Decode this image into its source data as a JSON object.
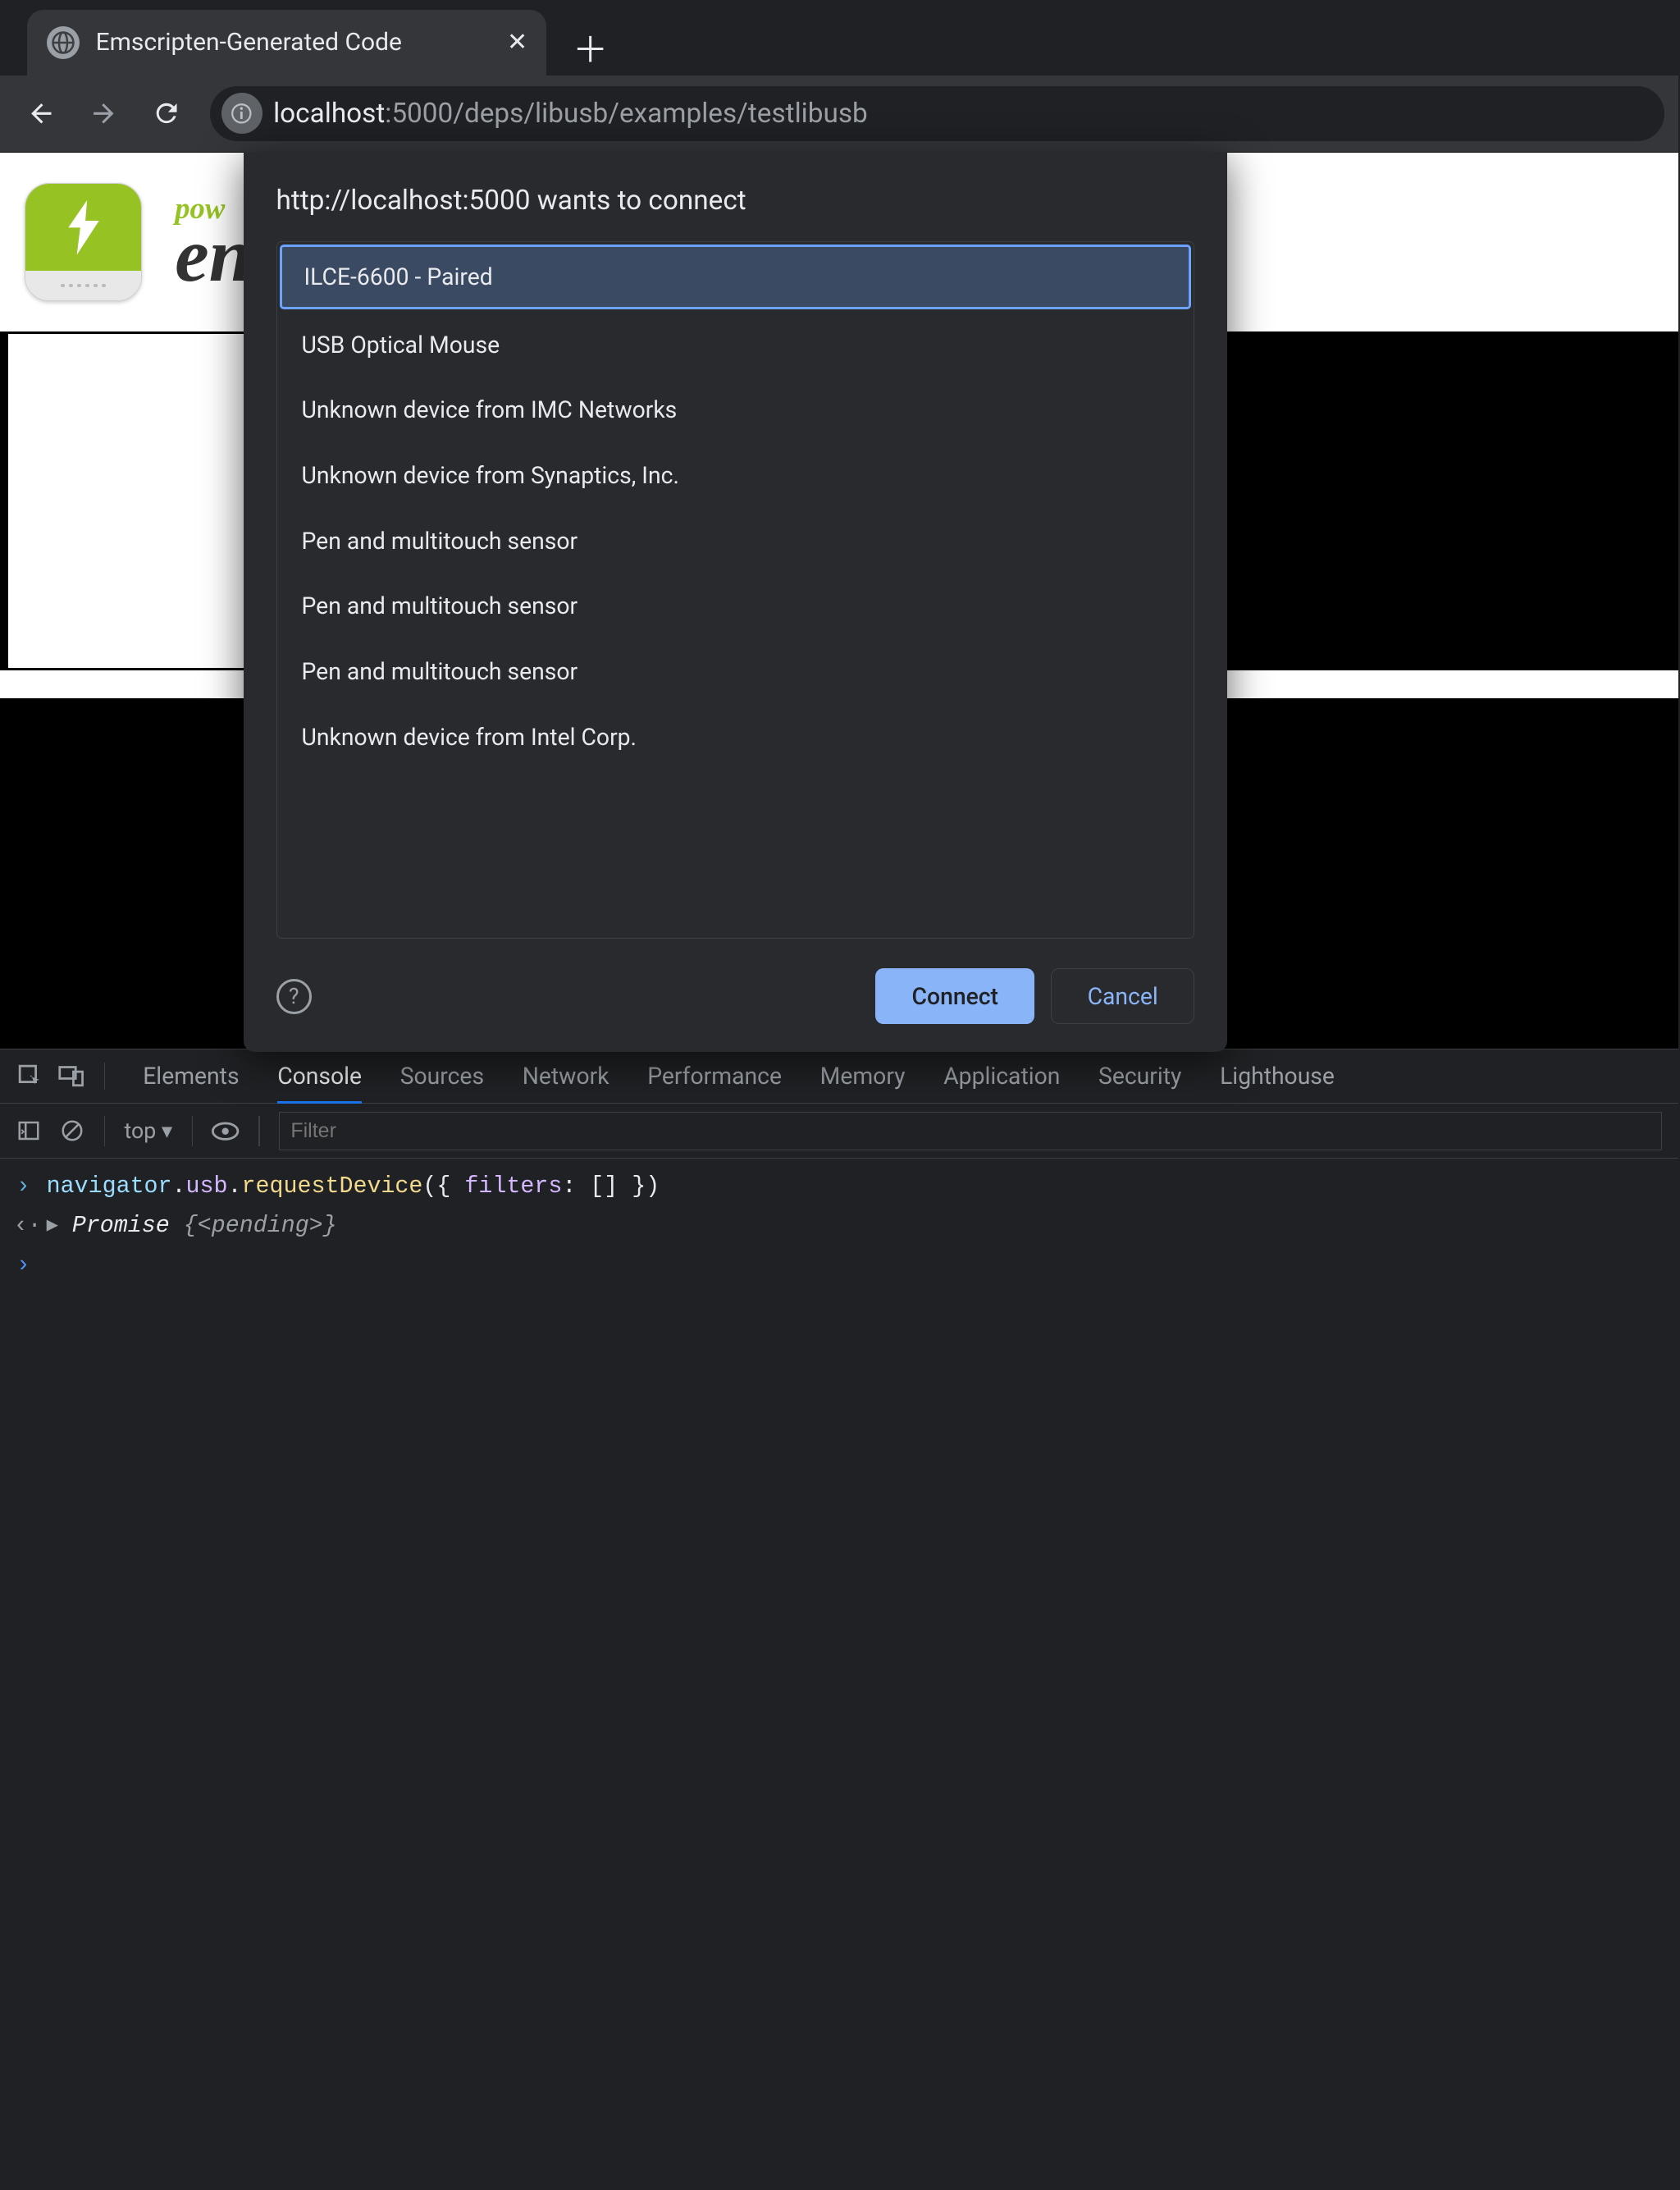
{
  "tab": {
    "title": "Emscripten-Generated Code"
  },
  "address": {
    "host": "localhost",
    "rest": ":5000/deps/libusb/examples/testlibusb"
  },
  "page": {
    "logo_small": "pow",
    "logo_big": "en"
  },
  "dialog": {
    "title": "http://localhost:5000 wants to connect",
    "devices": [
      "ILCE-6600 - Paired",
      "USB Optical Mouse",
      "Unknown device from IMC Networks",
      "Unknown device from Synaptics, Inc.",
      "Pen and multitouch sensor",
      "Pen and multitouch sensor",
      "Pen and multitouch sensor",
      "Unknown device from Intel Corp."
    ],
    "selected_index": 0,
    "connect": "Connect",
    "cancel": "Cancel"
  },
  "devtools": {
    "tabs": [
      "Elements",
      "Console",
      "Sources",
      "Network",
      "Performance",
      "Memory",
      "Application",
      "Security",
      "Lighthouse"
    ],
    "active_tab": "Console",
    "context": "top",
    "filter_placeholder": "Filter",
    "console": {
      "input": "navigator.usb.requestDevice({ filters: [] })",
      "output_prefix": "▸ ",
      "output_promise": "Promise",
      "output_state": "{<pending>}"
    }
  }
}
